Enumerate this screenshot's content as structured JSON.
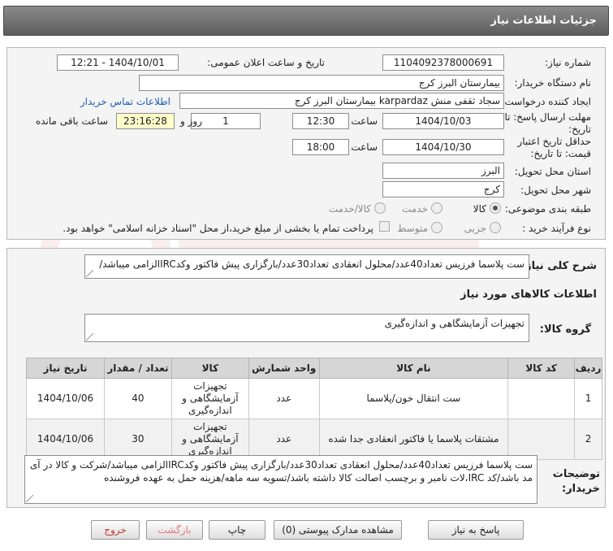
{
  "header": {
    "title": "جزئیات اطلاعات نیاز"
  },
  "form": {
    "need_number": {
      "label": "شماره نیاز:",
      "value": "1104092378000691"
    },
    "announce_datetime": {
      "label": "تاریخ و ساعت اعلان عمومی:",
      "value": "1404/10/01 - 12:21"
    },
    "buyer_org": {
      "label": "نام دستگاه خریدار:",
      "value": "بیمارستان البرز کرج"
    },
    "requester": {
      "label": "ایجاد کننده درخواست:",
      "value": "سجاد ثقفی منش karpardaz بیمارستان البرز کرج",
      "contact_link": "اطلاعات تماس خریدار"
    },
    "reply_deadline": {
      "label": "مهلت ارسال پاسخ: تا تاریخ:",
      "date": "1404/10/03",
      "time_label": "ساعت",
      "time": "12:30",
      "days": "1",
      "days_label": "روز و",
      "remaining": "23:16:28",
      "remaining_label": "ساعت باقی مانده"
    },
    "price_validity": {
      "label": "حداقل تاریخ اعتبار قیمت: تا تاریخ:",
      "date": "1404/10/30",
      "time_label": "ساعت",
      "time": "18:00"
    },
    "province": {
      "label": "استان محل تحویل:",
      "value": "البرز"
    },
    "city": {
      "label": "شهر محل تحویل:",
      "value": "کرج"
    },
    "category": {
      "label": "طبقه بندی موضوعی:",
      "options": [
        "کالا",
        "خدمت",
        "کالا/خدمت"
      ],
      "selected": "کالا"
    },
    "process_type": {
      "label": "نوع فرآیند خرید :",
      "options": [
        "جزیی",
        "متوسط"
      ],
      "payment_note": "پرداخت تمام یا بخشی از مبلغ خرید،از محل \"اسناد خزانه اسلامی\" خواهد بود."
    }
  },
  "summary": {
    "label": "شرح کلی نیاز:",
    "value": "ست پلاسما فرزیس تعداد40عدد/محلول انعقادی تعداد30عدد/بارگزاری پیش فاکتور وکدIRCالزامی میباشد/"
  },
  "goods_info": {
    "title": "اطلاعات کالاهای مورد نیاز",
    "group_label": "گروه کالا:",
    "group_value": "تجهیزات آزمایشگاهی و اندازه‌گیری"
  },
  "table": {
    "headers": [
      "ردیف",
      "کد کالا",
      "نام کالا",
      "واحد شمارش",
      "کالا",
      "تعداد / مقدار",
      "تاریخ نیاز"
    ],
    "rows": [
      [
        "1",
        "",
        "ست انتقال خون/پلاسما",
        "عدد",
        "تجهیزات آزمایشگاهی و اندازه‌گیری",
        "40",
        "1404/10/06"
      ],
      [
        "2",
        "",
        "مشتقات پلاسما یا فاکتور انعقادی جدا شده",
        "عدد",
        "تجهیزات آزمایشگاهی و اندازه‌گیری",
        "30",
        "1404/10/06"
      ]
    ]
  },
  "buyer_notes": {
    "label": "توضیحات خریدار:",
    "value": "ست پلاسما فرزیس تعداد40عدد/محلول انعقادی تعداد30عدد/بارگزاری پیش فاکتور وکدIRCالزامی میباشد/شرکت و کالا در آی مد باشد/کد IRC،لات نامبر و برچسب اصالت کالا داشته باشد/تسویه سه ماهه/هزینه حمل به عهده فروشنده"
  },
  "buttons": {
    "reply": "پاسخ به نیاز",
    "attachments": "مشاهده مدارک پیوستی (0)",
    "print": "چاپ",
    "back": "بازگشت",
    "exit": "خروج"
  }
}
